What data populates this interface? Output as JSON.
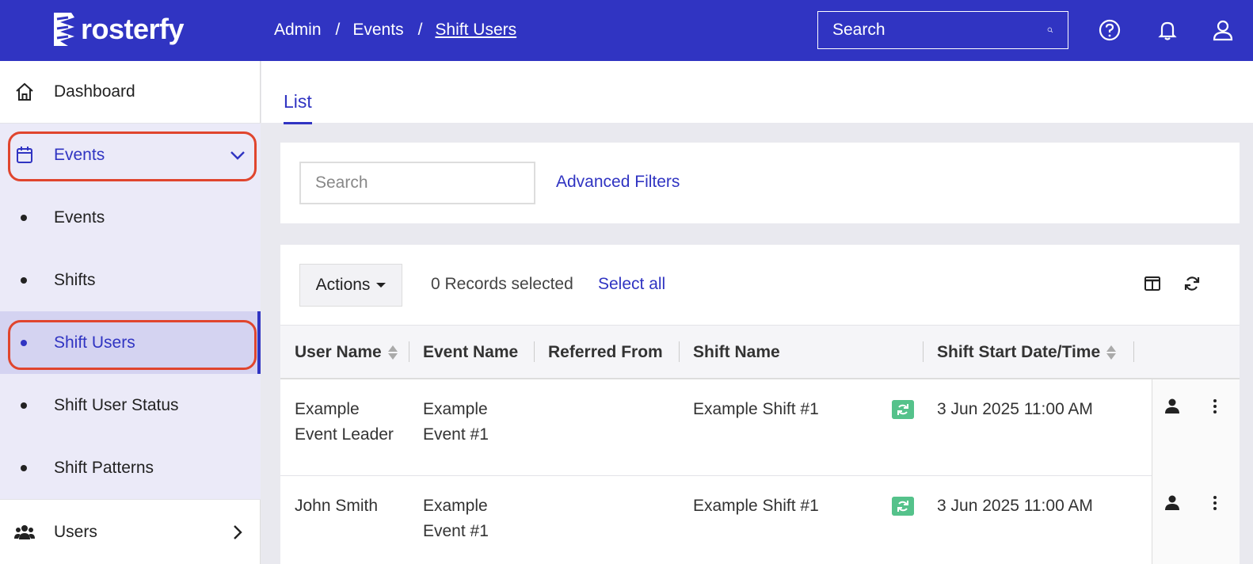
{
  "header": {
    "brand": "rosterfy",
    "breadcrumb": [
      "Admin",
      "Events",
      "Shift Users"
    ],
    "search_placeholder": "Search",
    "icons": [
      "help-icon",
      "bell-icon",
      "user-icon"
    ],
    "color": "#3034c2"
  },
  "sidebar": {
    "dashboard": "Dashboard",
    "events_group": "Events",
    "sub_items": [
      "Events",
      "Shifts",
      "Shift Users",
      "Shift User Status",
      "Shift Patterns"
    ],
    "active_sub": "Shift Users",
    "users": "Users"
  },
  "main": {
    "tab": "List",
    "filter_search_placeholder": "Search",
    "advanced_filters": "Advanced Filters",
    "actions_label": "Actions",
    "records_selected": "0 Records selected",
    "select_all": "Select all",
    "columns": [
      "User Name",
      "Event Name",
      "Referred From",
      "Shift Name",
      "Shift Start Date/Time"
    ],
    "rows": [
      {
        "user_name_1": "Example",
        "user_name_2": "Event Leader",
        "event_name_1": "Example",
        "event_name_2": "Event #1",
        "referred_from": "",
        "shift_name": "Example Shift #1",
        "start": "3 Jun 2025 11:00 AM"
      },
      {
        "user_name_1": "John Smith",
        "user_name_2": "",
        "event_name_1": "Example",
        "event_name_2": "Event #1",
        "referred_from": "",
        "shift_name": "Example Shift #1",
        "start": "3 Jun 2025 11:00 AM"
      }
    ]
  }
}
